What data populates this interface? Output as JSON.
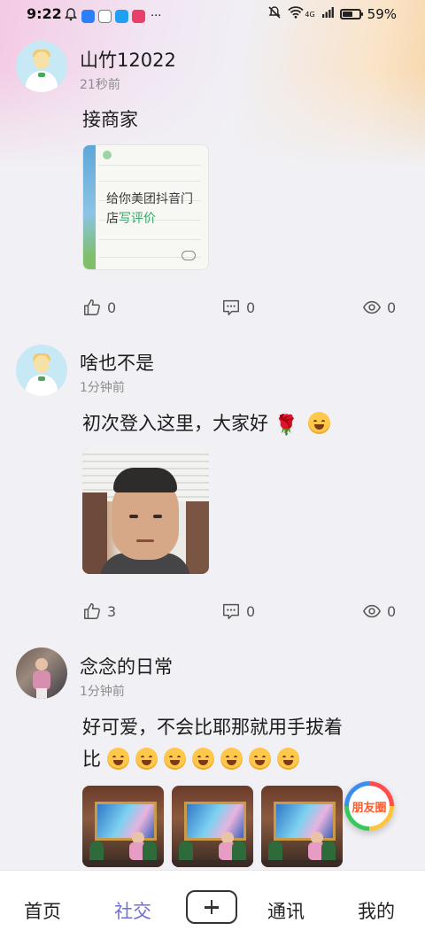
{
  "status_bar": {
    "time": "9:22",
    "more": "···",
    "network": "4G",
    "battery": "59%"
  },
  "posts": [
    {
      "username": "山竹12022",
      "time": "21秒前",
      "text": "接商家",
      "card_title_a": "给你美团抖音门",
      "card_title_b": "店",
      "card_title_c": "写评价",
      "likes": "0",
      "comments": "0",
      "views": "0"
    },
    {
      "username": "啥也不是",
      "time": "1分钟前",
      "text": "初次登入这里，大家好",
      "likes": "3",
      "comments": "0",
      "views": "0"
    },
    {
      "username": "念念的日常",
      "time": "1分钟前",
      "text_line1": "好可爱，不会比耶那就用手拔着",
      "text_line2": "比"
    }
  ],
  "float_badge": {
    "label": "朋友圈"
  },
  "tabbar": {
    "home": "首页",
    "social": "社交",
    "contacts": "通讯",
    "me": "我的",
    "accent": "#6f6fd8"
  }
}
